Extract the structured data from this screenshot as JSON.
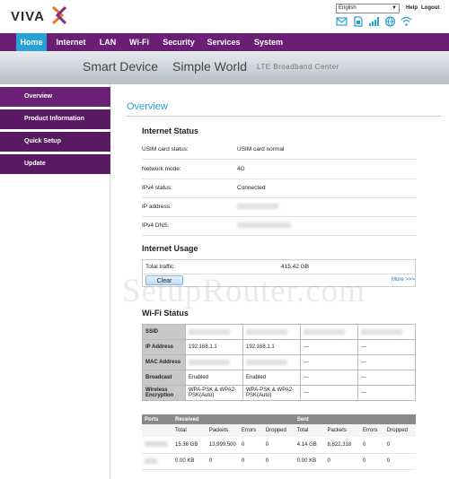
{
  "header": {
    "logo_text": "VIVA",
    "language": "English",
    "help_label": "Help",
    "logout_label": "Logout",
    "status_icons": [
      "mail-icon",
      "sim-icon",
      "signal-icon",
      "globe-icon",
      "wifi-icon"
    ]
  },
  "nav": {
    "items": [
      "Home",
      "Internet",
      "LAN",
      "Wi-Fi",
      "Security",
      "Services",
      "System"
    ],
    "active": "Home"
  },
  "banner": {
    "tagline_left": "Smart Device",
    "tagline_right": "Simple World",
    "subtitle": "LTE Broadband Center"
  },
  "sidebar": {
    "items": [
      "Overview",
      "Product Information",
      "Quick Setup",
      "Update"
    ],
    "active": "Overview"
  },
  "main": {
    "page_title": "Overview",
    "internet_status": {
      "title": "Internet Status",
      "rows": [
        {
          "label": "USIM card status:",
          "value": "USIM card normal"
        },
        {
          "label": "Network mode:",
          "value": "4G"
        },
        {
          "label": "IPv4 status:",
          "value": "Connected"
        },
        {
          "label": "IP address:",
          "value": ""
        },
        {
          "label": "IPv4 DNS:",
          "value": ""
        }
      ]
    },
    "internet_usage": {
      "title": "Internet Usage",
      "total_traffic_label": "Total traffic:",
      "total_traffic_value": "415.42 GB",
      "clear_button": "Clear",
      "more_link": "More >>>"
    },
    "wifi_status": {
      "title": "Wi-Fi Status",
      "rows": [
        {
          "label": "SSID",
          "cells": [
            "",
            "",
            "",
            ""
          ]
        },
        {
          "label": "IP Address",
          "cells": [
            "192.168.1.1",
            "192.168.1.1",
            "---",
            "---"
          ]
        },
        {
          "label": "MAC Address",
          "cells": [
            "",
            "",
            "---",
            "---"
          ]
        },
        {
          "label": "Broadcast",
          "cells": [
            "Enabled",
            "Enabled",
            "---",
            "---"
          ]
        },
        {
          "label": "Wireless Encryption",
          "cells": [
            "WPA-PSK & WPA2-PSK(Auto)",
            "WPA-PSK & WPA2-PSK(Auto)",
            "---",
            "---"
          ]
        }
      ]
    },
    "ports": {
      "header": {
        "ports": "Ports",
        "received": "Received",
        "sent": "Sent"
      },
      "columns": [
        "Total",
        "Packets",
        "Errors",
        "Dropped",
        "Total",
        "Packets",
        "Errors",
        "Dropped"
      ],
      "rows": [
        {
          "port": "",
          "values": [
            "15.36 GB",
            "13,999,500",
            "0",
            "0",
            "4.14 GB",
            "8,822,318",
            "0",
            "0"
          ]
        },
        {
          "port": "",
          "values": [
            "0.00 KB",
            "0",
            "0",
            "0",
            "0.00 KB",
            "0",
            "0",
            "0"
          ]
        }
      ]
    }
  },
  "watermark": "SetupRouter.com",
  "colors": {
    "nav_bg": "#6a1f74",
    "nav_active": "#28a0d8",
    "title_blue": "#28a0d8",
    "sidebar_bg": "#5a1a63"
  }
}
